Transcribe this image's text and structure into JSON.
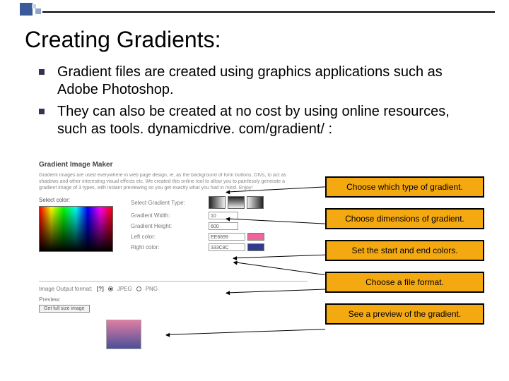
{
  "title": "Creating Gradients:",
  "bullets": [
    "Gradient files are created using graphics applications such as Adobe Photoshop.",
    "They can also be created at no cost by using online resources, such as tools. dynamicdrive. com/gradient/ :"
  ],
  "screenshot": {
    "heading": "Gradient Image Maker",
    "blurb": "Gradient images are used everywhere in web page design, ie, as the background of form buttons, DIVs, to act as shadows and other interesting visual effects etc. We created this online tool to allow you to painlessly generate a gradient image of 3 types, with instant previewing so you get exactly what you had in mind. Enjoy!",
    "select_color_label": "Select color:",
    "form": {
      "type_label": "Select Gradient Type:",
      "width_label": "Gradient Width:",
      "height_label": "Gradient Height:",
      "left_label": "Left color:",
      "right_label": "Right color:",
      "width_value": "10",
      "height_value": "600",
      "left_value": "EE6699",
      "right_value": "333C8C"
    },
    "output": {
      "label": "Image Output format:",
      "q": "[?]",
      "jpeg": "JPEG",
      "png": "PNG"
    },
    "preview_label": "Preview:",
    "preview_btn": "Get full size image"
  },
  "callouts": [
    "Choose which type of gradient.",
    "Choose dimensions of gradient.",
    "Set the start and end colors.",
    "Choose a file format.",
    "See a preview of the gradient."
  ]
}
